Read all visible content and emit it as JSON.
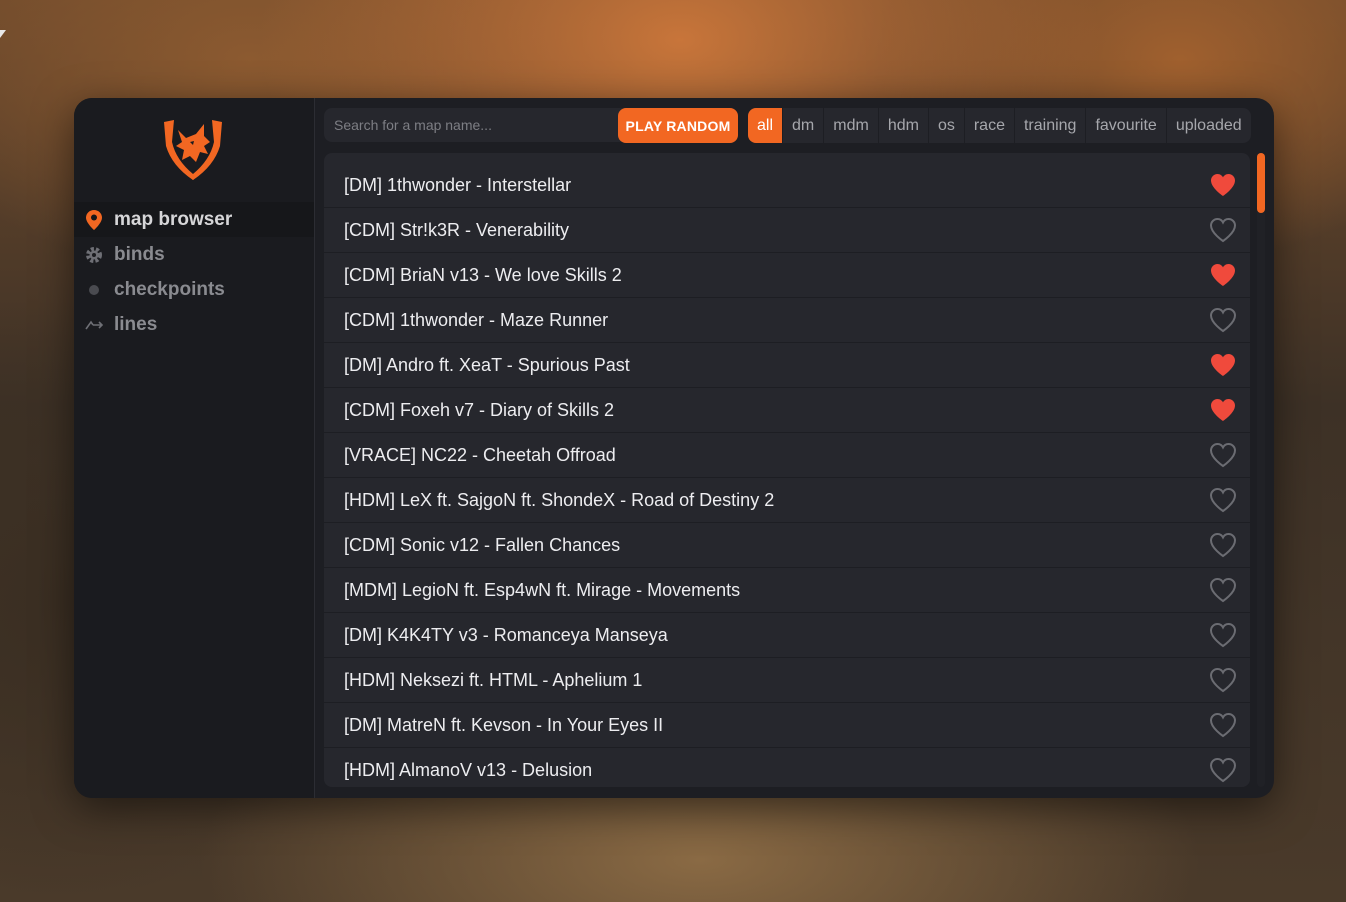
{
  "colors": {
    "accent": "#f26722",
    "heart_filled": "#f04a3c",
    "heart_empty": "#6b6c72"
  },
  "sidebar": {
    "logo_icon": "wolf-shield-logo",
    "items": [
      {
        "label": "map browser",
        "icon": "map-pin-icon",
        "active": true
      },
      {
        "label": "binds",
        "icon": "gear-icon",
        "active": false
      },
      {
        "label": "checkpoints",
        "icon": "dot-icon",
        "active": false
      },
      {
        "label": "lines",
        "icon": "lines-icon",
        "active": false
      }
    ]
  },
  "toolbar": {
    "search_placeholder": "Search for a map name...",
    "search_value": "",
    "play_random_label": "PLAY RANDOM",
    "filters": [
      {
        "label": "all",
        "active": true
      },
      {
        "label": "dm",
        "active": false
      },
      {
        "label": "mdm",
        "active": false
      },
      {
        "label": "hdm",
        "active": false
      },
      {
        "label": "os",
        "active": false
      },
      {
        "label": "race",
        "active": false
      },
      {
        "label": "training",
        "active": false
      },
      {
        "label": "favourite",
        "active": false
      },
      {
        "label": "uploaded",
        "active": false
      }
    ]
  },
  "maps": [
    {
      "title": "[DM] 1thwonder - Interstellar",
      "favourite": true
    },
    {
      "title": "[CDM] Str!k3R - Venerability",
      "favourite": false
    },
    {
      "title": "[CDM] BriaN v13 - We love Skills 2",
      "favourite": true
    },
    {
      "title": "[CDM] 1thwonder - Maze Runner",
      "favourite": false
    },
    {
      "title": "[DM] Andro ft. XeaT - Spurious Past",
      "favourite": true
    },
    {
      "title": "[CDM] Foxeh v7 - Diary of Skills 2",
      "favourite": true
    },
    {
      "title": "[VRACE] NC22 - Cheetah Offroad",
      "favourite": false
    },
    {
      "title": "[HDM] LeX ft. SajgoN ft. ShondeX - Road of Destiny 2",
      "favourite": false
    },
    {
      "title": "[CDM] Sonic v12 - Fallen Chances",
      "favourite": false
    },
    {
      "title": "[MDM] LegioN ft. Esp4wN ft. Mirage - Movements",
      "favourite": false
    },
    {
      "title": "[DM] K4K4TY v3 - Romanceya Manseya",
      "favourite": false
    },
    {
      "title": "[HDM] Neksezi ft. HTML - Aphelium 1",
      "favourite": false
    },
    {
      "title": "[DM] MatreN ft. Kevson - In Your Eyes II",
      "favourite": false
    },
    {
      "title": "[HDM] AlmanoV v13 - Delusion",
      "favourite": false
    }
  ]
}
